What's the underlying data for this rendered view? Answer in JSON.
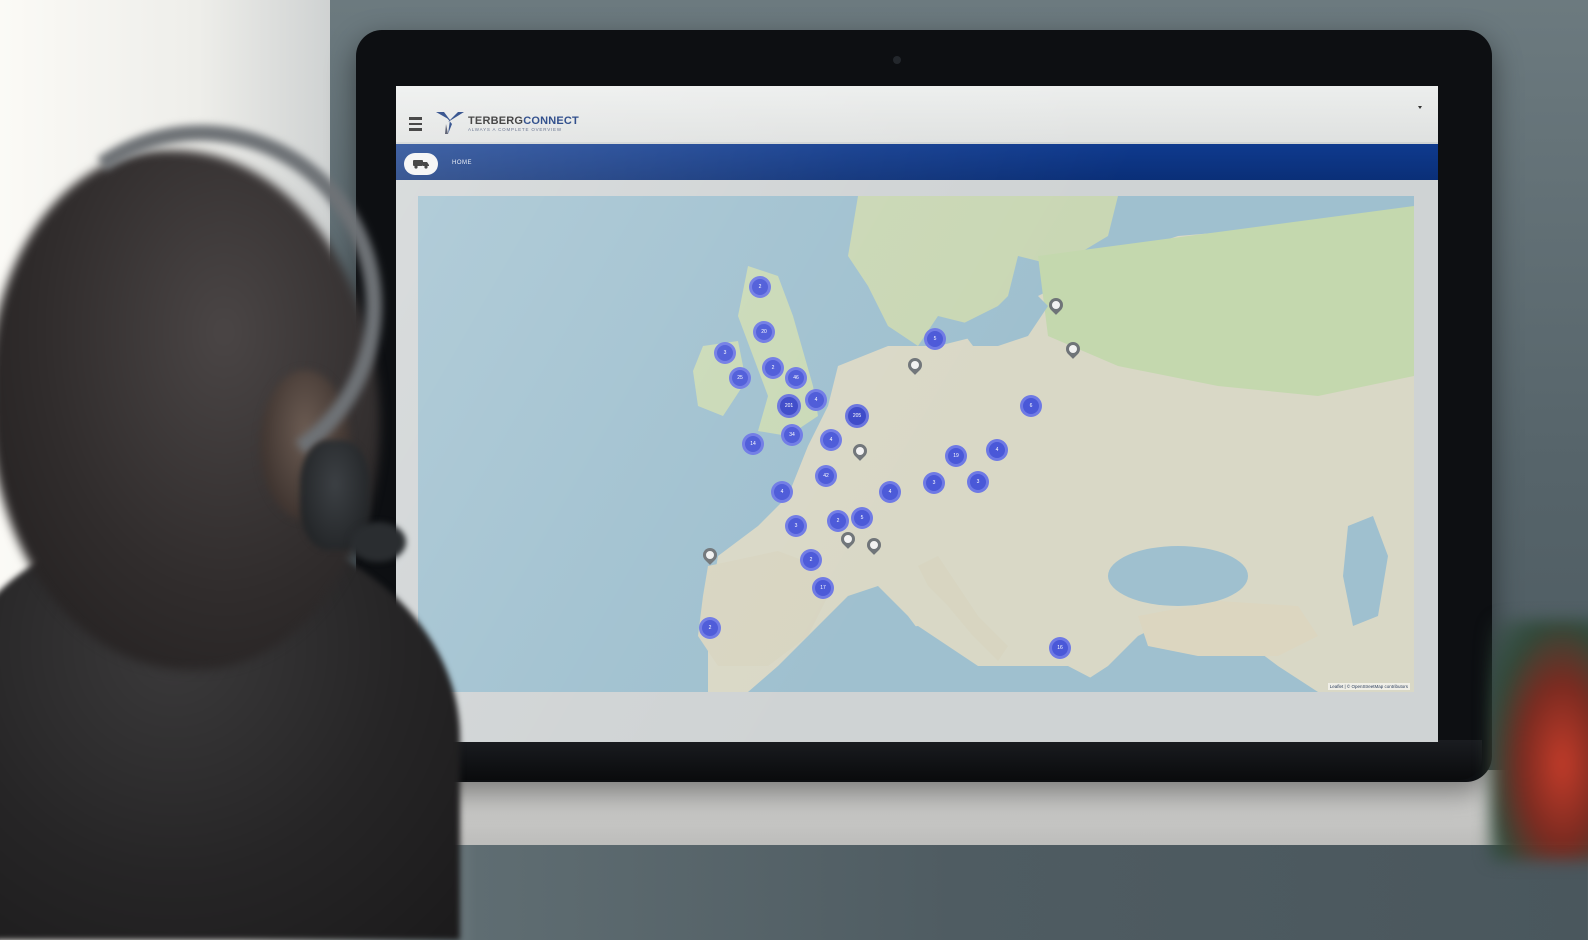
{
  "app": {
    "brand_prefix": "TERBERG",
    "brand_suffix": "CONNECT",
    "tagline": "ALWAYS A COMPLETE OVERVIEW"
  },
  "nav": {
    "home_label": "HOME"
  },
  "map": {
    "attribution": "Leaflet | © OpenStreetMap contributors",
    "clusters": [
      {
        "label": "2"
      },
      {
        "label": "20"
      },
      {
        "label": "3"
      },
      {
        "label": "2"
      },
      {
        "label": "25"
      },
      {
        "label": "46"
      },
      {
        "label": "201"
      },
      {
        "label": "4"
      },
      {
        "label": "14"
      },
      {
        "label": "34"
      },
      {
        "label": "205"
      },
      {
        "label": "4"
      },
      {
        "label": "42"
      },
      {
        "label": "4"
      },
      {
        "label": "3"
      },
      {
        "label": "2"
      },
      {
        "label": "5"
      },
      {
        "label": "4"
      },
      {
        "label": "2"
      },
      {
        "label": "17"
      },
      {
        "label": "5"
      },
      {
        "label": "19"
      },
      {
        "label": "3"
      },
      {
        "label": "3"
      },
      {
        "label": "4"
      },
      {
        "label": "6"
      },
      {
        "label": "2"
      },
      {
        "label": "16"
      }
    ]
  },
  "colors": {
    "nav_blue": "#0a2f78",
    "cluster": "#4a58d8",
    "brand_blue": "#0b2f77"
  },
  "icons": {
    "menu": "menu-icon",
    "vehicle": "truck-icon",
    "pin": "map-pin-icon"
  }
}
